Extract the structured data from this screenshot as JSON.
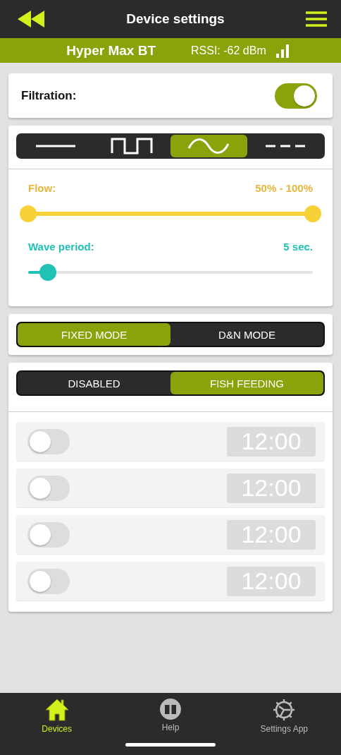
{
  "header": {
    "title": "Device settings"
  },
  "device": {
    "name": "Hyper Max BT",
    "rssi": "RSSI: -62 dBm"
  },
  "filtration": {
    "label": "Filtration:",
    "on": true
  },
  "wave_modes": [
    {
      "kind": "constant",
      "selected": false
    },
    {
      "kind": "pulse",
      "selected": false
    },
    {
      "kind": "sine",
      "selected": true
    },
    {
      "kind": "dashed",
      "selected": false
    }
  ],
  "flow": {
    "label": "Flow:",
    "reading": "50% - 100%",
    "level": 1
  },
  "wave_period": {
    "label": "Wave period:",
    "reading": "5 sec.",
    "level": 0.07
  },
  "modes": [
    {
      "label": "FIXED MODE",
      "selected": true
    },
    {
      "label": "D&N MODE",
      "selected": false
    }
  ],
  "feeding": [
    {
      "label": "DISABLED",
      "selected": false
    },
    {
      "label": "FISH FEEDING",
      "selected": true
    }
  ],
  "timers": [
    {
      "on": false,
      "time": "12:00"
    },
    {
      "on": false,
      "time": "12:00"
    },
    {
      "on": false,
      "time": "12:00"
    },
    {
      "on": false,
      "time": "12:00"
    }
  ],
  "nav": [
    {
      "kind": "home",
      "label": "Devices",
      "selected": true
    },
    {
      "kind": "book",
      "label": "Help",
      "selected": false
    },
    {
      "kind": "gear",
      "label": "Settings App",
      "selected": false
    }
  ]
}
